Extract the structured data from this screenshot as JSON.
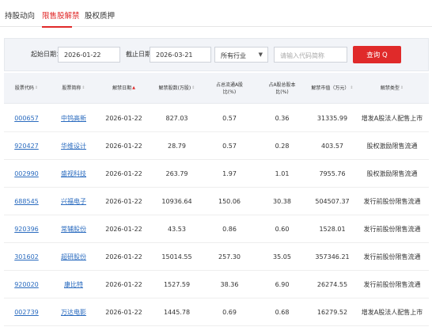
{
  "tabs": [
    "持股动向",
    "限售股解禁",
    "股权质押"
  ],
  "filter": {
    "start_label": "起始日期：",
    "start_value": "2026-01-22",
    "end_label": "截止日期：",
    "end_value": "2026-03-21",
    "industry_value": "所有行业",
    "search_placeholder": "请输入代码简称",
    "query_label": "查询 Q"
  },
  "table": {
    "headers": [
      "股票代码",
      "股票简称",
      "解禁日期",
      "解禁股数(万股)",
      "占总流通A股比(%)",
      "占A股总股本比(%)",
      "解禁市值（万元）",
      "解禁类型"
    ],
    "rows": [
      [
        "000657",
        "中钨高新",
        "2026-01-22",
        "827.03",
        "0.57",
        "0.36",
        "31335.99",
        "增发A股法人配售上市"
      ],
      [
        "920427",
        "华维设计",
        "2026-01-22",
        "28.79",
        "0.57",
        "0.28",
        "403.57",
        "股权激励限售流通"
      ],
      [
        "002990",
        "盛视科技",
        "2026-01-22",
        "263.79",
        "1.97",
        "1.01",
        "7955.76",
        "股权激励限售流通"
      ],
      [
        "688545",
        "兴福电子",
        "2026-01-22",
        "10936.64",
        "150.06",
        "30.38",
        "504507.37",
        "发行前股份限售流通"
      ],
      [
        "920396",
        "常辅股份",
        "2026-01-22",
        "43.53",
        "0.86",
        "0.60",
        "1528.01",
        "发行前股份限售流通"
      ],
      [
        "301602",
        "超研股份",
        "2026-01-22",
        "15014.55",
        "257.30",
        "35.05",
        "357346.21",
        "发行前股份限售流通"
      ],
      [
        "920020",
        "康比特",
        "2026-01-22",
        "1527.59",
        "38.36",
        "6.90",
        "26274.55",
        "发行前股份限售流通"
      ],
      [
        "002739",
        "万达电影",
        "2026-01-22",
        "1445.78",
        "0.69",
        "0.68",
        "16279.52",
        "增发A股法人配售上市"
      ]
    ]
  }
}
